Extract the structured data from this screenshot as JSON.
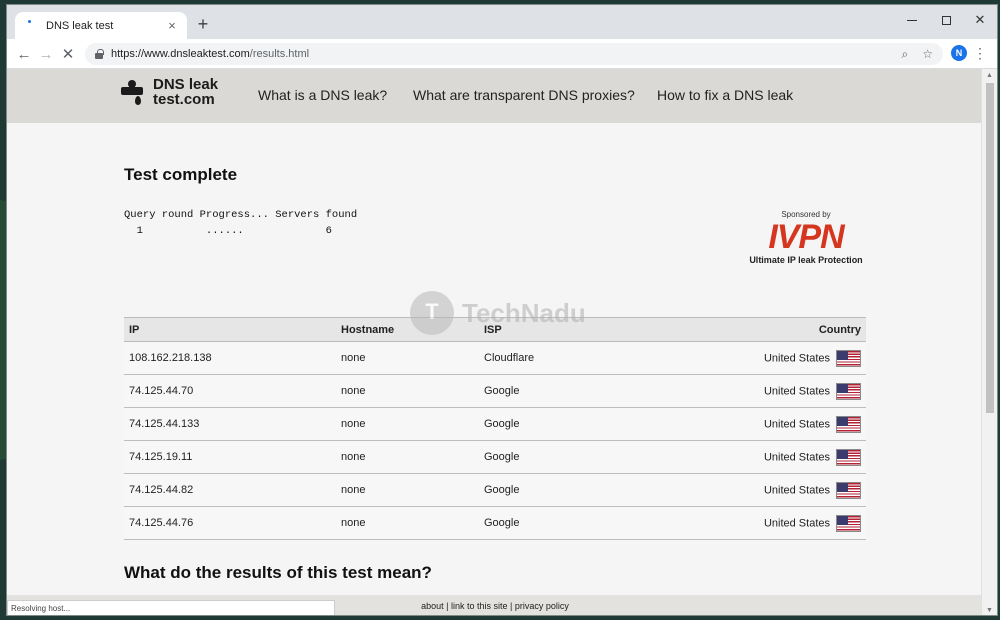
{
  "browser": {
    "tab_title": "DNS leak test",
    "tab_close": "×",
    "new_tab": "+",
    "url_host": "https://www.dnsleaktest.com",
    "url_path": "/results.html",
    "profile_initial": "N",
    "status_text": "Resolving host..."
  },
  "site": {
    "logo_line1": "DNS leak",
    "logo_line2": "test.com",
    "nav": [
      "What is a DNS leak?",
      "What are transparent DNS proxies?",
      "How to fix a DNS leak"
    ]
  },
  "main": {
    "heading": "Test complete",
    "progress_header": "Query round Progress... Servers found",
    "progress_row": "  1          ......             6",
    "sponsor_by": "Sponsored by",
    "sponsor_brand": "IVPN",
    "sponsor_tag": "Ultimate IP leak Protection",
    "watermark": "TechNadu",
    "table": {
      "headers": [
        "IP",
        "Hostname",
        "ISP",
        "Country"
      ],
      "rows": [
        {
          "ip": "108.162.218.138",
          "hostname": "none",
          "isp": "Cloudflare",
          "country": "United States"
        },
        {
          "ip": "74.125.44.70",
          "hostname": "none",
          "isp": "Google",
          "country": "United States"
        },
        {
          "ip": "74.125.44.133",
          "hostname": "none",
          "isp": "Google",
          "country": "United States"
        },
        {
          "ip": "74.125.19.11",
          "hostname": "none",
          "isp": "Google",
          "country": "United States"
        },
        {
          "ip": "74.125.44.82",
          "hostname": "none",
          "isp": "Google",
          "country": "United States"
        },
        {
          "ip": "74.125.44.76",
          "hostname": "none",
          "isp": "Google",
          "country": "United States"
        }
      ]
    },
    "subheading": "What do the results of this test mean?"
  },
  "footer": {
    "about": "about",
    "link": "link to this site",
    "privacy": "privacy policy",
    "sep": " | "
  },
  "colors": {
    "brand": "#d4361f",
    "header_bg": "#dbd9d5",
    "accent": "#1a73e8"
  }
}
